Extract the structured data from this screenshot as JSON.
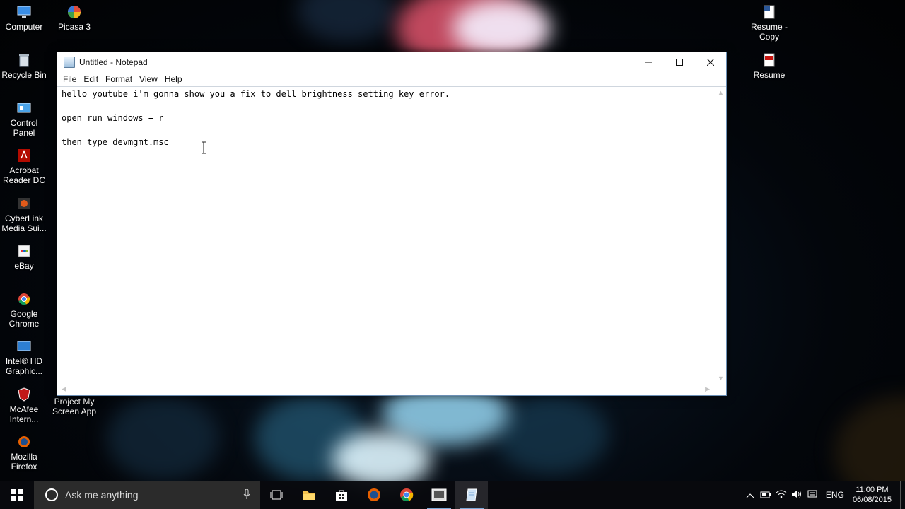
{
  "desktop": {
    "left_icons": [
      {
        "label": "Computer",
        "icon": "computer-icon"
      },
      {
        "label": "Recycle Bin",
        "icon": "recycle-bin-icon"
      },
      {
        "label": "Control Panel",
        "icon": "control-panel-icon"
      },
      {
        "label": "Acrobat Reader DC",
        "icon": "acrobat-icon"
      },
      {
        "label": "CyberLink Media Sui...",
        "icon": "cyberlink-icon"
      },
      {
        "label": "eBay",
        "icon": "ebay-icon"
      },
      {
        "label": "Google Chrome",
        "icon": "chrome-icon"
      },
      {
        "label": "Intel® HD Graphic...",
        "icon": "intel-icon"
      },
      {
        "label": "McAfee Intern...",
        "icon": "mcafee-icon"
      },
      {
        "label": "Mozilla Firefox",
        "icon": "firefox-icon"
      }
    ],
    "second_column_icons": [
      {
        "label": "Picasa 3",
        "icon": "picasa-icon"
      },
      {
        "label": "Project My Screen App",
        "icon": "project-screen-icon"
      }
    ],
    "right_icons": [
      {
        "label": "Resume - Copy",
        "icon": "word-doc-icon"
      },
      {
        "label": "Resume",
        "icon": "pdf-icon"
      }
    ]
  },
  "notepad": {
    "title": "Untitled - Notepad",
    "menu": [
      "File",
      "Edit",
      "Format",
      "View",
      "Help"
    ],
    "content": "hello youtube i'm gonna show you a fix to dell brightness setting key error.\n\nopen run windows + r\n\nthen type devmgmt.msc"
  },
  "taskbar": {
    "search_placeholder": "Ask me anything",
    "pinned": [
      {
        "name": "task-view",
        "icon": "task-view-icon"
      },
      {
        "name": "file-explorer",
        "icon": "folder-icon"
      },
      {
        "name": "store",
        "icon": "store-icon"
      },
      {
        "name": "firefox",
        "icon": "firefox-icon"
      },
      {
        "name": "chrome",
        "icon": "chrome-icon"
      },
      {
        "name": "screen-recorder",
        "icon": "recorder-icon"
      },
      {
        "name": "notepad",
        "icon": "notepad-icon"
      }
    ],
    "language": "ENG",
    "time": "11:00 PM",
    "date": "06/08/2015"
  },
  "colors": {
    "taskbar_bg": "#0a0c10",
    "accent": "#7aa7d6",
    "window_border": "#6b8fb5"
  }
}
